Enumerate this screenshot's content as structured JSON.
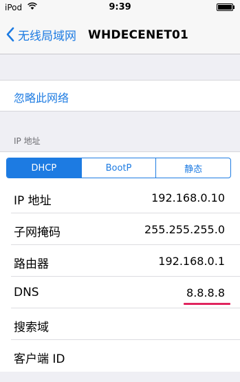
{
  "status_bar": {
    "carrier": "iPod",
    "time": "9:39"
  },
  "nav": {
    "back_label": "无线局域网",
    "title": "WHDECENET01"
  },
  "forget": {
    "label": "忽略此网络"
  },
  "section": {
    "header": "IP 地址"
  },
  "segments": [
    {
      "label": "DHCP",
      "selected": true
    },
    {
      "label": "BootP",
      "selected": false
    },
    {
      "label": "静态",
      "selected": false
    }
  ],
  "rows": [
    {
      "key": "IP 地址",
      "value": "192.168.0.10"
    },
    {
      "key": "子网掩码",
      "value": "255.255.255.0"
    },
    {
      "key": "路由器",
      "value": "192.168.0.1"
    },
    {
      "key": "DNS",
      "value": "8.8.8.8"
    },
    {
      "key": "搜索域",
      "value": ""
    },
    {
      "key": "客户端 ID",
      "value": ""
    }
  ],
  "colors": {
    "accent": "#1d7be2",
    "annotation": "#e0245e",
    "background": "#efeff4"
  }
}
